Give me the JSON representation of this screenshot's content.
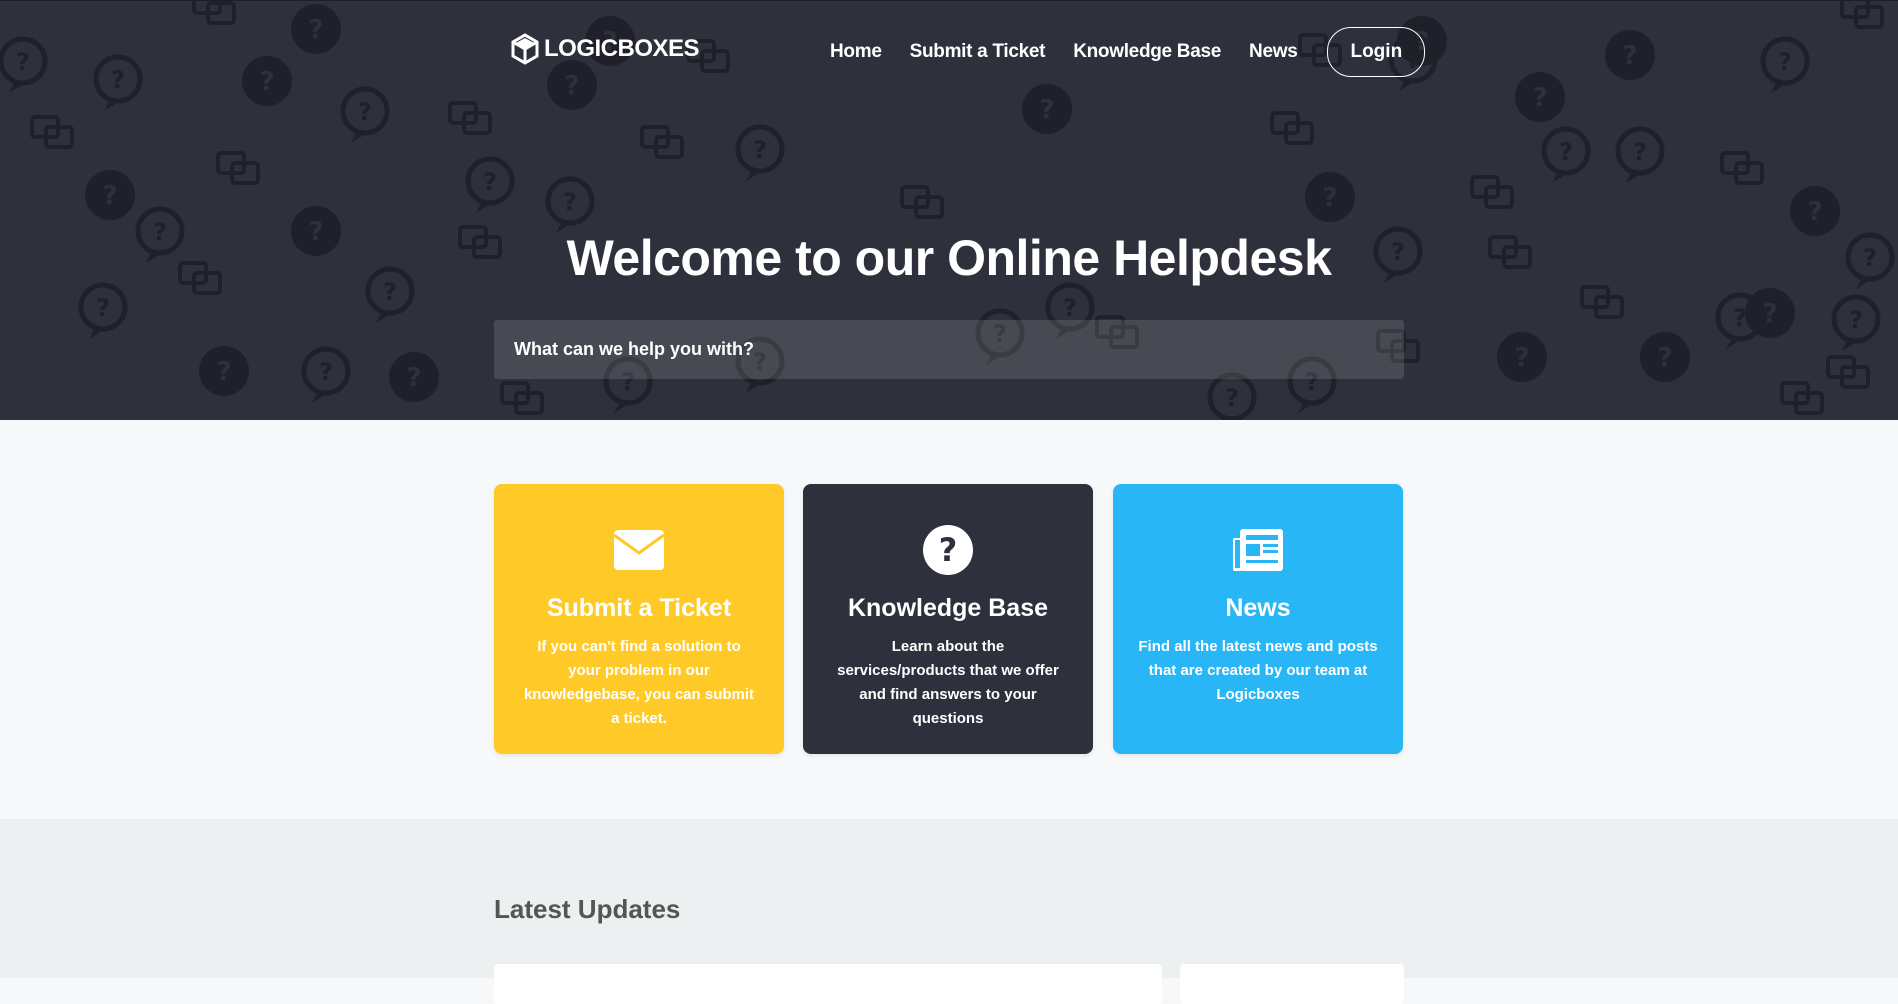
{
  "brand": {
    "name": "LOGICBOXES"
  },
  "nav": {
    "items": [
      {
        "label": "Home"
      },
      {
        "label": "Submit a Ticket"
      },
      {
        "label": "Knowledge Base"
      },
      {
        "label": "News"
      }
    ],
    "login_label": "Login"
  },
  "hero": {
    "title": "Welcome to our Online Helpdesk",
    "search_placeholder": "What can we help you with?"
  },
  "cards": [
    {
      "icon": "envelope-icon",
      "title": "Submit a Ticket",
      "description": "If you can't find a solution to your problem in our knowledgebase, you can submit a ticket.",
      "color": "#ffca28"
    },
    {
      "icon": "question-circle-icon",
      "title": "Knowledge Base",
      "description": "Learn about the services/products that we offer and find answers to your questions",
      "color": "#2e303c"
    },
    {
      "icon": "newspaper-icon",
      "title": "News",
      "description": "Find all the latest news and posts that are created by our team at Logicboxes",
      "color": "#29b6f6"
    }
  ],
  "updates": {
    "title": "Latest Updates"
  },
  "colors": {
    "hero_bg": "#2e303c",
    "page_bg": "#f6f8f9",
    "updates_bg": "#ecf0f1"
  }
}
